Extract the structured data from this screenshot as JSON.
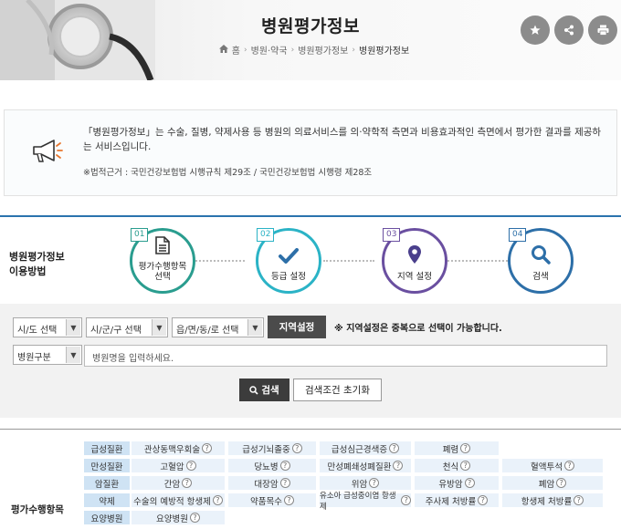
{
  "header": {
    "title": "병원평가정보",
    "breadcrumb": [
      "홈",
      "병원·약국",
      "병원평가정보",
      "병원평가정보"
    ],
    "buttons": [
      "star-icon",
      "share-icon",
      "print-icon"
    ]
  },
  "notice": {
    "message": "「병원평가정보」는 수술, 질병, 약제사용 등 병원의 의료서비스를 의·약학적 측면과 비용효과적인 측면에서 평가한 결과를 제공하는 서비스입니다.",
    "law": "※법적근거 : 국민건강보험법 시행규칙 제29조 / 국민건강보험법 시행령 제28조"
  },
  "steps": {
    "label_line1": "병원평가정보",
    "label_line2": "이용방법",
    "items": [
      {
        "num": "01",
        "label1": "평가수행항목",
        "label2": "선택",
        "color": "#2a9d8f"
      },
      {
        "num": "02",
        "label1": "등급 설정",
        "label2": "",
        "color": "#2bb3c6"
      },
      {
        "num": "03",
        "label1": "지역 설정",
        "label2": "",
        "color": "#6a4fa0"
      },
      {
        "num": "04",
        "label1": "검색",
        "label2": "",
        "color": "#2d6fa8"
      }
    ]
  },
  "search": {
    "sido": "시/도 선택",
    "sigungu": "시/군/구 선택",
    "eupmyeon": "읍/면/동/로 선택",
    "region_button": "지역설정",
    "region_note": "※ 지역설정은 중복으로 선택이 가능합니다.",
    "hospital_type": "병원구분",
    "name_placeholder": "병원명을 입력하세요.",
    "search_button": "검색",
    "reset_button": "검색조건 초기화"
  },
  "eval": {
    "label": "평가수행항목",
    "rows": [
      {
        "category": "급성질환",
        "items": [
          "관상동맥우회술",
          "급성기뇌졸중",
          "급성심근경색증",
          "폐렴"
        ]
      },
      {
        "category": "만성질환",
        "items": [
          "고혈압",
          "당뇨병",
          "만성폐쇄성폐질환",
          "천식",
          "혈액투석"
        ]
      },
      {
        "category": "암질환",
        "items": [
          "간암",
          "대장암",
          "위암",
          "유방암",
          "폐암"
        ]
      },
      {
        "category": "약제",
        "items": [
          "수술의 예방적 항생제",
          "약품목수",
          "유소아 급성중이염 항생제",
          "주사제 처방률",
          "항생제 처방률"
        ]
      },
      {
        "category": "요양병원",
        "items": [
          "요양병원"
        ]
      }
    ]
  }
}
